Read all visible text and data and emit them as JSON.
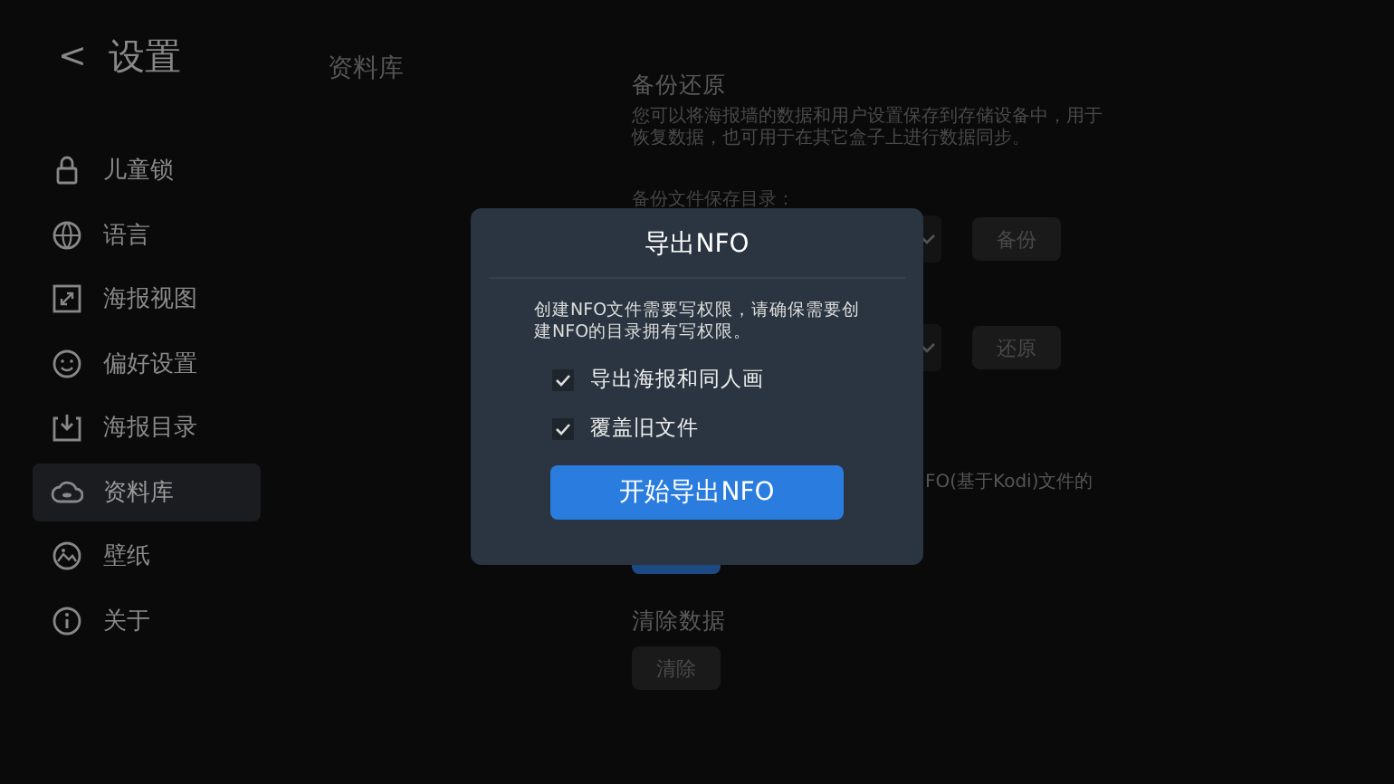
{
  "sidebar": {
    "back": "<",
    "title": "设置",
    "items": [
      {
        "label": "儿童锁",
        "selected": false
      },
      {
        "label": "语言",
        "selected": false
      },
      {
        "label": "海报视图",
        "selected": false
      },
      {
        "label": "偏好设置",
        "selected": false
      },
      {
        "label": "海报目录",
        "selected": false
      },
      {
        "label": "资料库",
        "selected": true
      },
      {
        "label": "壁纸",
        "selected": false
      },
      {
        "label": "关于",
        "selected": false
      }
    ]
  },
  "main": {
    "title": "资料库",
    "backup": {
      "heading": "备份还原",
      "description": "您可以将海报墙的数据和用户设置保存到存储设备中，用于恢复数据，也可用于在其它盒子上进行数据同步。",
      "dir_label": "备份文件保存目录：",
      "backup_button": "备份",
      "restore_button": "还原"
    },
    "nfo_note": "FO(基于Kodi)文件的",
    "clear": {
      "heading": "清除数据",
      "button": "清除"
    }
  },
  "dialog": {
    "title": "导出NFO",
    "message": "创建NFO文件需要写权限，请确保需要创建NFO的目录拥有写权限。",
    "options": [
      {
        "label": "导出海报和同人画",
        "checked": true
      },
      {
        "label": "覆盖旧文件",
        "checked": true
      }
    ],
    "button": "开始导出NFO"
  }
}
